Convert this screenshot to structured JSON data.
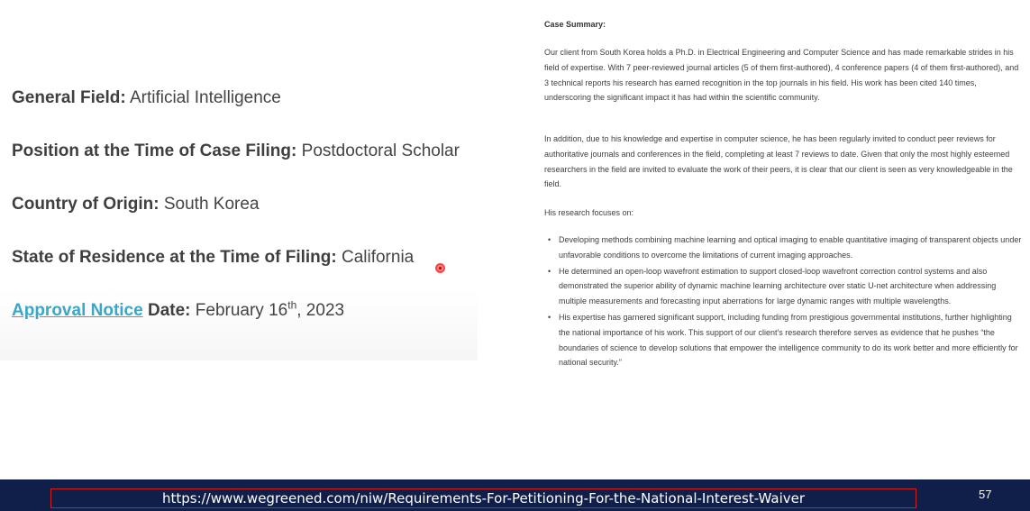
{
  "left": {
    "general_field": {
      "label": "General Field:",
      "value": "Artificial Intelligence"
    },
    "position": {
      "label": "Position at the Time of Case Filing:",
      "value": "Postdoctoral Scholar"
    },
    "country": {
      "label": "Country of Origin:",
      "value": "South Korea"
    },
    "state": {
      "label": "State of Residence at the Time of Filing:",
      "value": "California"
    },
    "approval": {
      "link_text": "Approval Notice",
      "label": "Date:",
      "value_pre": "February 16",
      "value_sup": "th",
      "value_post": ", 2023"
    }
  },
  "right": {
    "heading": "Case Summary:",
    "paragraph1": "Our client from South Korea holds a Ph.D. in Electrical Engineering and Computer Science and has made remarkable strides in his field of expertise. With 7 peer-reviewed journal articles (5 of them first-authored), 4 conference papers (4 of them first-authored), and 3 technical reports his research has earned recognition in the top journals in his field. His work has been cited 140 times, underscoring the significant impact it has had within the scientific community.",
    "paragraph2": "In addition, due to his knowledge and expertise in computer science, he has been regularly invited to conduct peer reviews for authoritative journals and conferences in the field, completing at least 7 reviews to date. Given that only the most highly esteemed researchers in the field are invited to evaluate the work of their peers, it is clear that our client is seen as very knowledgeable in the field.",
    "paragraph3": "His research focuses on:",
    "bullets": [
      "Developing methods combining machine learning and optical imaging to enable quantitative imaging of transparent objects under unfavorable conditions to overcome the limitations of current imaging approaches.",
      "He determined an open-loop wavefront estimation to support closed-loop wavefront correction control systems and also demonstrated the superior ability of dynamic machine learning architecture over static U-net architecture when addressing multiple measurements and forecasting input aberrations for large dynamic ranges with multiple wavelengths.",
      "His expertise has garnered significant support, including funding from prestigious governmental institutions, further highlighting the national importance of his work. This support of our client’s research therefore serves as evidence that he pushes “the boundaries of science to develop solutions that empower the intelligence community to do its work better and more efficiently for national security.”"
    ]
  },
  "footer": {
    "url": "https://www.wegreened.com/niw/Requirements-For-Petitioning-For-the-National-Interest-Waiver",
    "page_number": "57"
  },
  "colors": {
    "footer_bg": "#0f1f4a",
    "link": "#3aa6c9",
    "url_border": "#d21e1e"
  }
}
